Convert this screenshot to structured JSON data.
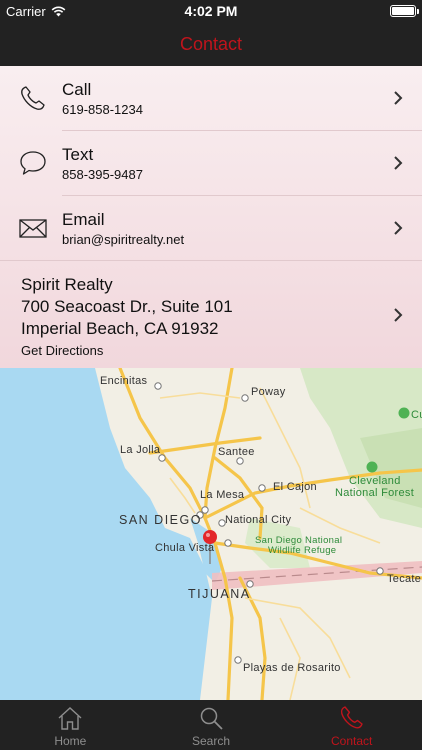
{
  "status": {
    "carrier": "Carrier",
    "time": "4:02 PM"
  },
  "nav": {
    "title": "Contact"
  },
  "contacts": [
    {
      "label": "Call",
      "value": "619-858-1234",
      "icon": "phone-icon"
    },
    {
      "label": "Text",
      "value": "858-395-9487",
      "icon": "speech-bubble-icon"
    },
    {
      "label": "Email",
      "value": "brian@spiritrealty.net",
      "icon": "envelope-icon"
    }
  ],
  "address": {
    "name": "Spirit Realty",
    "line1": "700 Seacoast Dr., Suite 101",
    "line2": "Imperial Beach, CA 91932",
    "action": "Get Directions"
  },
  "map": {
    "labels": {
      "encinitas": "Encinitas",
      "poway": "Poway",
      "la_jolla": "La Jolla",
      "santee": "Santee",
      "la_mesa": "La Mesa",
      "el_cajon": "El Cajon",
      "cleveland1": "Cleveland",
      "cleveland2": "National Forest",
      "san_diego": "SAN DIEGO",
      "national_city": "National City",
      "refuge1": "San Diego National",
      "refuge2": "Wildlife Refuge",
      "chula_vista": "Chula Vista",
      "tijuana": "TIJUANA",
      "tecate": "Tecate",
      "rosarito": "Playas de Rosarito",
      "cu": "Cu"
    },
    "marker": "pin-icon"
  },
  "tabs": [
    {
      "label": "Home",
      "icon": "home-icon",
      "active": false
    },
    {
      "label": "Search",
      "icon": "search-icon",
      "active": false
    },
    {
      "label": "Contact",
      "icon": "phone-icon",
      "active": true
    }
  ],
  "colors": {
    "accent": "#c0141c",
    "bar": "#222222",
    "list_top": "#f9eef0",
    "list_bottom": "#f1d7dc",
    "water": "#a9d9f2",
    "land": "#f2efe5"
  }
}
